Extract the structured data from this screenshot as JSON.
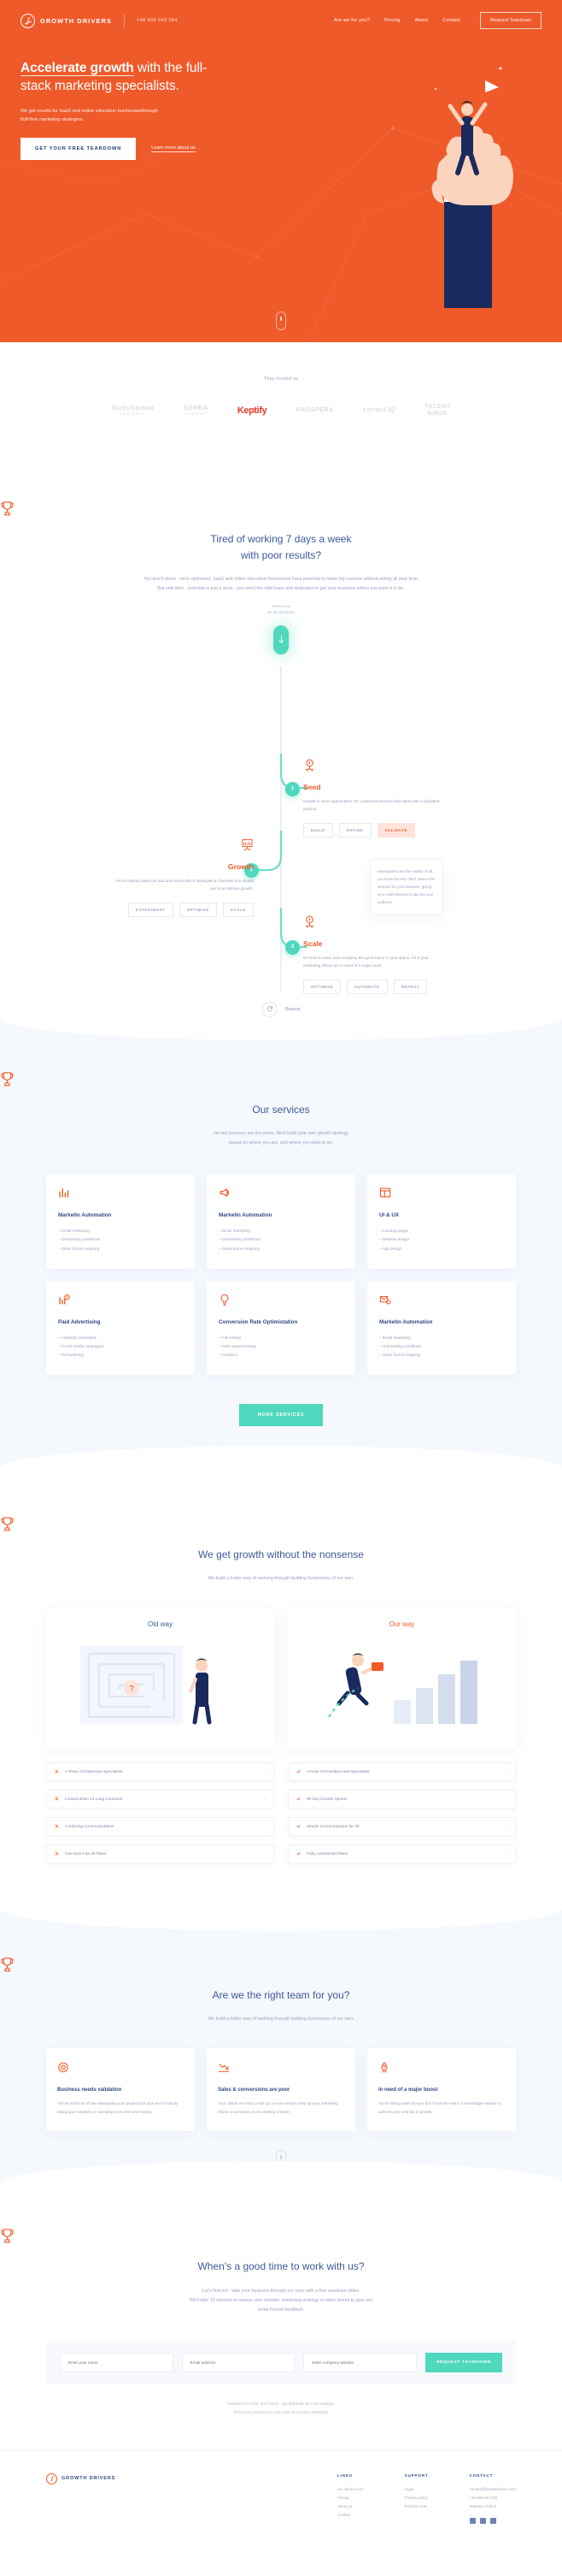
{
  "nav": {
    "brand": "GROWTH DRIVERS",
    "phone": "+48 606 543 054",
    "links": [
      "Are we for you?",
      "Pricing",
      "About",
      "Contact"
    ],
    "cta": "Request Teardown"
  },
  "hero": {
    "title_strong": "Accelerate growth",
    "title_rest": " with the full-stack marketing specialists.",
    "sub": "We get results for SaaS and online education businessesthrough fluff-free marketing strategies.",
    "primary_btn": "GET YOUR FREE TEARDOWN",
    "secondary_link": "Learn more about us"
  },
  "trusted": {
    "label": "They trusted us",
    "logos": [
      {
        "name": "StudyAbroad",
        "sub": "Apartments",
        "accent": false
      },
      {
        "name": "GEMBA",
        "sub": "ACADEMY",
        "accent": false
      },
      {
        "name": "Keptify",
        "sub": "",
        "accent": true
      },
      {
        "name": "RAGSPERA",
        "sub": "",
        "accent": false
      },
      {
        "name": "extract IQ",
        "sub": "",
        "accent": false
      },
      {
        "name": "TALENT",
        "sub": "NINJA",
        "accent": false
      }
    ]
  },
  "tired": {
    "title_l1": "Tired of working 7 days a week",
    "title_l2": "with poor results?",
    "body": "You aren't alone - once optimized, SaaS and online education businesses have potential to make big revenue without eating all your time. But until then - potential is just a word - you need the right team and strategies to get your business where you want it to be."
  },
  "timeline": {
    "start_label_l1": "Here's how",
    "start_label_l2": "we get you there",
    "steps": [
      {
        "num": "1",
        "name": "Seed",
        "desc": "Growth is never guaranteed. It's a personal process that starts with a validated product.",
        "chips": [
          "BUILD",
          "REFINE",
          "VALIDATE"
        ],
        "active_chip": "VALIDATE",
        "tooltip": "Assumptions are the mother of all... you know the rest. We'll assess the demand for your business, giving us a solid blueprint to tap into your audience",
        "icon": "seed-icon"
      },
      {
        "num": "2",
        "name": "Growth",
        "desc": "You're making sales but you don't know which strategies & channels you should use to accelerate growth.",
        "chips": [
          "EXPERIMENT",
          "OPTIMISE",
          "SCALE"
        ],
        "active_chip": "",
        "tooltip": "",
        "icon": "growth-chart-icon"
      },
      {
        "num": "3",
        "name": "Scale",
        "desc": "It's time to make your company the go-to name in your space. All of your marketing efforts are in need of a major push.",
        "chips": [
          "OPTIMISE",
          "AUTOMATE",
          "REPEAT"
        ],
        "active_chip": "",
        "tooltip": "",
        "icon": "scale-icon"
      }
    ],
    "repeat_label": "Repeat"
  },
  "services": {
    "title": "Our services",
    "sub_l1": "No two journeys are the same. We'll build your own growth strategy",
    "sub_l2": "based on where you are, and where you want to go.",
    "cards": [
      {
        "title": "Marketin Automation",
        "icon": "bar-chart-icon",
        "items": [
          "Email marketing",
          "Onboarding workflows",
          "Sales funnel mapping"
        ]
      },
      {
        "title": "Marketin Automation",
        "icon": "megaphone-icon",
        "items": [
          "Email marketing",
          "Onboarding workflows",
          "Sales funnel mapping"
        ]
      },
      {
        "title": "UI & UX",
        "icon": "layout-icon",
        "items": [
          "Landing pages",
          "Website design",
          "App design"
        ]
      },
      {
        "title": "Paid Advertising",
        "icon": "money-chart-icon",
        "items": [
          "Adwords campaigns",
          "Social media campaigns",
          "Remarketing"
        ]
      },
      {
        "title": "Conversion Rate Optimistation",
        "icon": "lightbulb-icon",
        "items": [
          "A/B testing",
          "Multi-variant testing",
          "Analytics"
        ]
      },
      {
        "title": "Marketin Automation",
        "icon": "gear-mail-icon",
        "items": [
          "Email marketing",
          "Onboarding workflows",
          "Sales funnel mapping"
        ]
      }
    ],
    "more_btn": "MORE SERVICES"
  },
  "nonsense": {
    "title": "We get growth without the nonsense",
    "sub": "We build a better way of working through building businesses of our own.",
    "old_way": "Old way",
    "our_way": "Our way",
    "old_items": [
      "A Team of Expensive Specialists",
      "Locked-down 12 Long Contracts",
      "Confusing Communications",
      "One-Size-Fits-All Plans"
    ],
    "our_items": [
      "A team of Founders and Specialists",
      "90 Day Growth Sprints",
      "Simple Communication for All",
      "Fully customised Plans"
    ]
  },
  "team": {
    "title": "Are we the right team for you?",
    "sub": "We build a better way of working through building businesses of our own.",
    "cards": [
      {
        "title": "Business needs validation",
        "icon": "target-icon",
        "desc": "You've build lots of new developing your product but your aren't exactly taking your numbers or spending more time and money."
      },
      {
        "title": "Sales & conversions are poor",
        "icon": "chart-down-icon",
        "desc": "Your clients are busy on the go, so you need to step up your marketing efforts to purchase you're seeking a break."
      },
      {
        "title": "In need of a major boost",
        "icon": "rocket-icon",
        "desc": "You're taking sales but you don't have the team or knowledge needed to achieve your next tier in growth."
      }
    ]
  },
  "contact": {
    "title": "When's a good time to work with us?",
    "sub_l1": "Let's find out - take your business through our eyes with a free teardown video.",
    "sub_l2": "We'll take 15 minutes to assess your website, marketing strategy or sales funnel to give you",
    "sub_l3": "some honest feedback.",
    "fields": [
      "Enter your name",
      "Email address",
      "Enter company website"
    ],
    "submit": "REQUEST TEARDOWN",
    "note_l1": "Teardowns is a free and honest - just deliberate its a raw analysis.",
    "note_l2": "We'll never pressure you into a sale of any kind afterwards."
  },
  "footer": {
    "brand": "GROWTH DRIVERS",
    "columns": [
      {
        "heading": "LINKS",
        "items": [
          "Are we for you?",
          "Pricing",
          "About us",
          "Contact"
        ]
      },
      {
        "heading": "SUPPORT",
        "items": [
          "Legal",
          "Privacy policy",
          "Email us now"
        ]
      },
      {
        "heading": "CONTACT",
        "items": [
          "contact@growthdrivers.com",
          "+48 606 543 054",
          "Warsaw, Poland"
        ]
      }
    ]
  },
  "colors": {
    "brand_orange": "#ef5a2a",
    "accent_teal": "#4fd8bd",
    "heading_blue": "#3d5a99",
    "muted": "#9aa4bd",
    "panel_bg": "#f5f8fd"
  }
}
